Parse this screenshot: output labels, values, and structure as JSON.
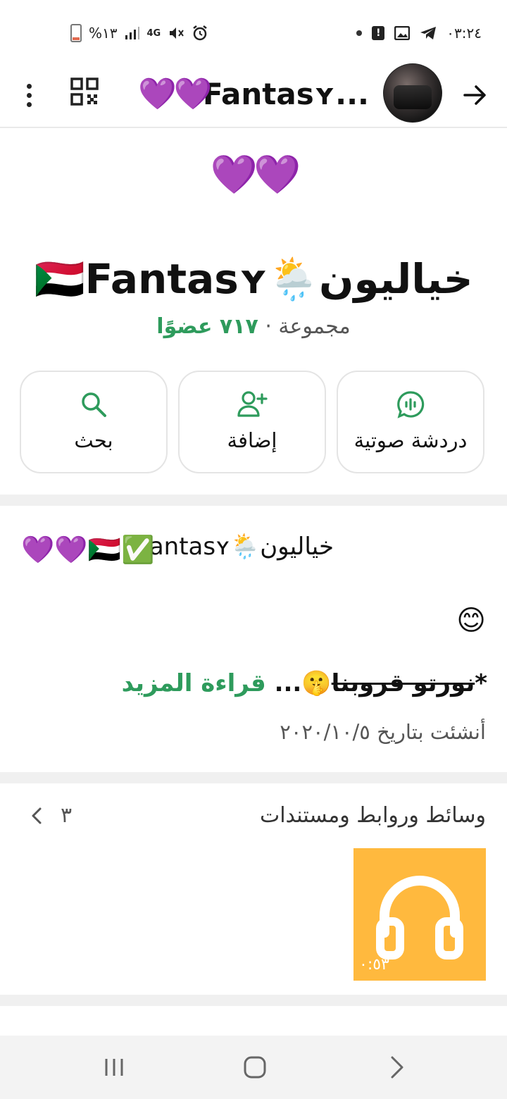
{
  "status_bar": {
    "time": "٠٣:٢٤",
    "battery": "%١٣",
    "network": "4G",
    "icons_right": [
      "dot-icon",
      "alert-icon",
      "gallery-icon",
      "telegram-icon"
    ],
    "icons_left": [
      "battery-icon",
      "signal-icon",
      "4g-icon",
      "mute-icon",
      "alarm-icon"
    ]
  },
  "toolbar": {
    "title": "Fantasʏ...",
    "hearts": "💜💜"
  },
  "header": {
    "hearts": "💜💜",
    "name": "خياليون🌦️🇸🇩Fantasʏ",
    "sub_prefix": "مجموعة · ",
    "member_count": "٧١٧ عضوًا",
    "actions": [
      {
        "label": "دردشة صوتية",
        "icon": "voice-chat-icon"
      },
      {
        "label": "إضافة",
        "icon": "add-user-icon"
      },
      {
        "label": "بحث",
        "icon": "search-icon"
      }
    ]
  },
  "description": {
    "title": "خياليون🌦️Fantasʏ",
    "title_emojis": "💜💜🇸🇩✅",
    "smile": "😊",
    "star": "*",
    "strike_text": "نورتو قروبنا",
    "tail": "🤫...",
    "read_more": "قراءة المزيد",
    "created": "أنشئت بتاريخ ٢٠٢٠/١٠/٥"
  },
  "media": {
    "title": "وسائط وروابط ومستندات",
    "count": "٣",
    "item_duration": "٠:٥٣"
  },
  "colors": {
    "accent": "#2e9b5c",
    "thumb": "#ffb93e",
    "heart": "#8a3be0"
  }
}
